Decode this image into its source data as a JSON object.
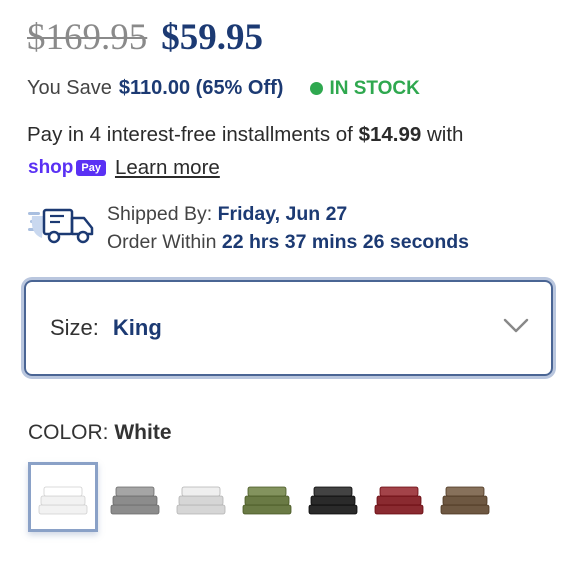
{
  "price": {
    "original": "$169.95",
    "sale": "$59.95"
  },
  "savings": {
    "label": "You Save",
    "amount": "$110.00 (65% Off)",
    "stock_status": "IN STOCK"
  },
  "installments": {
    "prefix": "Pay in 4 interest-free installments of ",
    "amount": "$14.99",
    "suffix": " with",
    "shop_word": "shop",
    "pay_badge": "Pay",
    "learn_more": "Learn more"
  },
  "shipping": {
    "shipped_by_label": "Shipped By:",
    "shipped_by_value": "Friday, Jun 27",
    "order_within_label": "Order Within",
    "order_within_value": "22 hrs 37 mins 26 seconds"
  },
  "size": {
    "label": "Size:",
    "value": "King"
  },
  "color": {
    "label": "COLOR:",
    "value": "White",
    "swatches": [
      {
        "name": "white",
        "color": "#f2f2f2",
        "selected": true
      },
      {
        "name": "gray",
        "color": "#8c8c8c"
      },
      {
        "name": "light-gray",
        "color": "#d6d6d6"
      },
      {
        "name": "olive",
        "color": "#6a7a45"
      },
      {
        "name": "black",
        "color": "#2a2a2a"
      },
      {
        "name": "burgundy",
        "color": "#8a2a30"
      },
      {
        "name": "brown",
        "color": "#6e5842"
      }
    ]
  },
  "colors": {
    "brand_blue": "#1c3a73",
    "stock_green": "#2fa84f",
    "shop_purple": "#5a31f4"
  }
}
